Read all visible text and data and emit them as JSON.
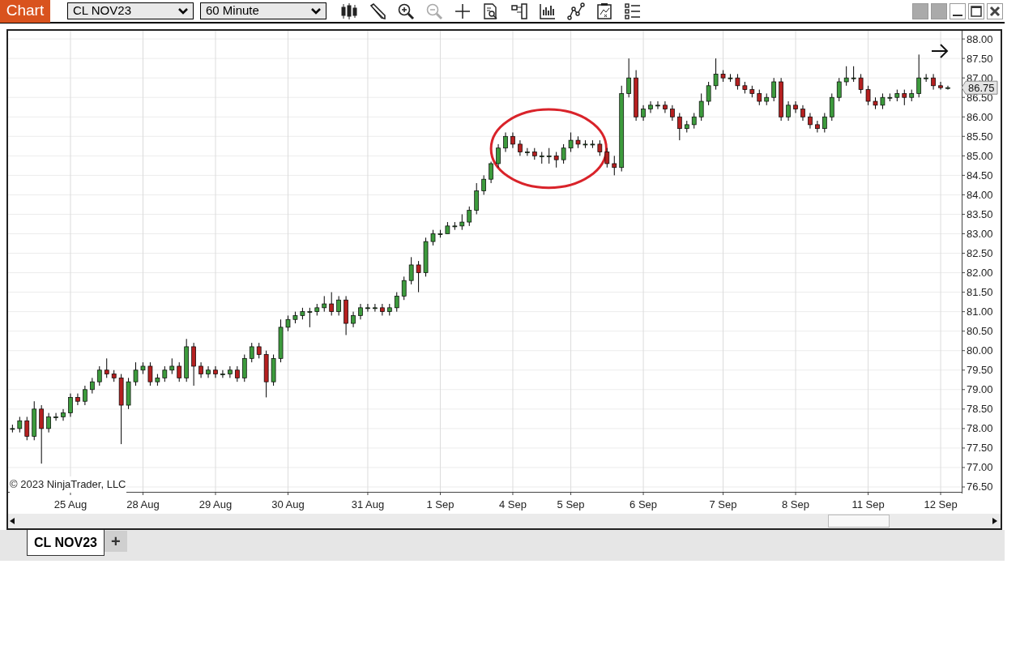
{
  "toolbar": {
    "title": "Chart",
    "instrument": "CL NOV23",
    "interval": "60 Minute"
  },
  "chart": {
    "copyright": "© 2023 NinjaTrader, LLC",
    "price_marker": "86.75",
    "highlight": {
      "kind": "ellipse"
    },
    "chart_data": {
      "type": "candlestick",
      "grid": true,
      "categories": [
        null,
        null,
        null,
        null,
        null,
        null,
        null,
        null,
        "25 Aug",
        null,
        null,
        null,
        null,
        null,
        null,
        null,
        null,
        null,
        "28 Aug",
        null,
        null,
        null,
        null,
        null,
        null,
        null,
        null,
        null,
        "29 Aug",
        null,
        null,
        null,
        null,
        null,
        null,
        null,
        null,
        null,
        "30 Aug",
        null,
        null,
        null,
        null,
        null,
        null,
        null,
        null,
        null,
        null,
        "31 Aug",
        null,
        null,
        null,
        null,
        null,
        null,
        null,
        null,
        null,
        "1 Sep",
        null,
        null,
        null,
        null,
        null,
        null,
        null,
        null,
        null,
        "4 Sep",
        null,
        null,
        null,
        null,
        null,
        null,
        null,
        "5 Sep",
        null,
        null,
        null,
        null,
        null,
        null,
        null,
        null,
        null,
        "6 Sep",
        null,
        null,
        null,
        null,
        null,
        null,
        null,
        null,
        null,
        null,
        "7 Sep",
        null,
        null,
        null,
        null,
        null,
        null,
        null,
        null,
        null,
        "8 Sep",
        null,
        null,
        null,
        null,
        null,
        null,
        null,
        null,
        null,
        "11 Sep",
        null,
        null,
        null,
        null,
        null,
        null,
        null,
        null,
        null,
        "12 Sep",
        null
      ],
      "ohlc": [
        [
          78.0,
          78.1,
          77.9,
          78.0
        ],
        [
          78.0,
          78.3,
          77.9,
          78.2
        ],
        [
          78.2,
          78.3,
          77.7,
          77.8
        ],
        [
          77.8,
          78.7,
          77.7,
          78.5
        ],
        [
          78.5,
          78.6,
          77.1,
          78.0
        ],
        [
          78.0,
          78.4,
          77.9,
          78.3
        ],
        [
          78.3,
          78.4,
          78.2,
          78.3
        ],
        [
          78.3,
          78.5,
          78.2,
          78.4
        ],
        [
          78.4,
          78.9,
          78.3,
          78.8
        ],
        [
          78.8,
          78.9,
          78.6,
          78.7
        ],
        [
          78.7,
          79.1,
          78.6,
          79.0
        ],
        [
          79.0,
          79.3,
          78.9,
          79.2
        ],
        [
          79.2,
          79.6,
          79.1,
          79.5
        ],
        [
          79.5,
          79.8,
          79.3,
          79.4
        ],
        [
          79.4,
          79.5,
          79.2,
          79.3
        ],
        [
          79.3,
          79.4,
          77.6,
          78.6
        ],
        [
          78.6,
          79.3,
          78.5,
          79.2
        ],
        [
          79.2,
          79.7,
          79.1,
          79.5
        ],
        [
          79.5,
          79.7,
          79.4,
          79.6
        ],
        [
          79.6,
          79.7,
          79.1,
          79.2
        ],
        [
          79.2,
          79.4,
          79.1,
          79.3
        ],
        [
          79.3,
          79.6,
          79.2,
          79.5
        ],
        [
          79.5,
          79.8,
          79.4,
          79.6
        ],
        [
          79.6,
          79.7,
          79.2,
          79.3
        ],
        [
          79.3,
          80.3,
          79.2,
          80.1
        ],
        [
          80.1,
          80.2,
          79.1,
          79.6
        ],
        [
          79.6,
          79.7,
          79.3,
          79.4
        ],
        [
          79.4,
          79.6,
          79.3,
          79.5
        ],
        [
          79.5,
          79.6,
          79.3,
          79.4
        ],
        [
          79.4,
          79.5,
          79.3,
          79.4
        ],
        [
          79.4,
          79.6,
          79.3,
          79.5
        ],
        [
          79.5,
          79.6,
          79.2,
          79.3
        ],
        [
          79.3,
          79.9,
          79.2,
          79.8
        ],
        [
          79.8,
          80.2,
          79.7,
          80.1
        ],
        [
          80.1,
          80.2,
          79.8,
          79.9
        ],
        [
          79.9,
          80.0,
          78.8,
          79.2
        ],
        [
          79.2,
          79.9,
          79.1,
          79.8
        ],
        [
          79.8,
          80.8,
          79.7,
          80.6
        ],
        [
          80.6,
          80.9,
          80.5,
          80.8
        ],
        [
          80.8,
          81.0,
          80.7,
          80.9
        ],
        [
          80.9,
          81.1,
          80.8,
          81.0
        ],
        [
          81.0,
          81.1,
          80.6,
          81.0
        ],
        [
          81.0,
          81.2,
          80.9,
          81.1
        ],
        [
          81.1,
          81.4,
          81.0,
          81.2
        ],
        [
          81.2,
          81.5,
          80.9,
          81.0
        ],
        [
          81.0,
          81.4,
          80.9,
          81.3
        ],
        [
          81.3,
          81.4,
          80.4,
          80.7
        ],
        [
          80.7,
          81.0,
          80.6,
          80.9
        ],
        [
          80.9,
          81.2,
          80.8,
          81.1
        ],
        [
          81.1,
          81.2,
          81.0,
          81.1
        ],
        [
          81.1,
          81.2,
          81.0,
          81.1
        ],
        [
          81.1,
          81.2,
          80.9,
          81.0
        ],
        [
          81.0,
          81.2,
          80.9,
          81.1
        ],
        [
          81.1,
          81.5,
          81.0,
          81.4
        ],
        [
          81.4,
          81.9,
          81.3,
          81.8
        ],
        [
          81.8,
          82.4,
          81.7,
          82.2
        ],
        [
          82.2,
          82.3,
          81.5,
          82.0
        ],
        [
          82.0,
          82.9,
          81.9,
          82.8
        ],
        [
          82.8,
          83.1,
          82.7,
          83.0
        ],
        [
          83.0,
          83.1,
          82.9,
          83.0
        ],
        [
          83.0,
          83.3,
          83.0,
          83.2
        ],
        [
          83.2,
          83.3,
          83.1,
          83.2
        ],
        [
          83.2,
          83.5,
          83.1,
          83.3
        ],
        [
          83.3,
          83.7,
          83.2,
          83.6
        ],
        [
          83.6,
          84.3,
          83.5,
          84.1
        ],
        [
          84.1,
          84.5,
          84.0,
          84.4
        ],
        [
          84.4,
          84.85,
          84.3,
          84.8
        ],
        [
          84.8,
          85.3,
          84.7,
          85.2
        ],
        [
          85.2,
          85.6,
          85.1,
          85.5
        ],
        [
          85.5,
          85.6,
          85.2,
          85.3
        ],
        [
          85.3,
          85.4,
          85.0,
          85.1
        ],
        [
          85.1,
          85.2,
          85.0,
          85.1
        ],
        [
          85.1,
          85.2,
          84.9,
          85.0
        ],
        [
          85.0,
          85.1,
          84.8,
          85.0
        ],
        [
          85.0,
          85.2,
          84.8,
          85.0
        ],
        [
          85.0,
          85.1,
          84.7,
          84.9
        ],
        [
          84.9,
          85.3,
          84.8,
          85.2
        ],
        [
          85.2,
          85.6,
          85.1,
          85.4
        ],
        [
          85.4,
          85.5,
          85.2,
          85.3
        ],
        [
          85.3,
          85.4,
          85.2,
          85.3
        ],
        [
          85.3,
          85.4,
          85.2,
          85.3
        ],
        [
          85.3,
          85.4,
          85.0,
          85.1
        ],
        [
          85.1,
          85.2,
          84.7,
          84.8
        ],
        [
          84.8,
          85.0,
          84.5,
          84.7
        ],
        [
          84.7,
          86.8,
          84.6,
          86.6
        ],
        [
          86.6,
          87.5,
          86.5,
          87.0
        ],
        [
          87.0,
          87.2,
          85.9,
          86.0
        ],
        [
          86.0,
          86.3,
          85.9,
          86.2
        ],
        [
          86.2,
          86.4,
          86.1,
          86.3
        ],
        [
          86.3,
          86.4,
          86.2,
          86.3
        ],
        [
          86.3,
          86.4,
          86.1,
          86.2
        ],
        [
          86.2,
          86.3,
          85.9,
          86.0
        ],
        [
          86.0,
          86.1,
          85.4,
          85.7
        ],
        [
          85.7,
          85.9,
          85.6,
          85.8
        ],
        [
          85.8,
          86.1,
          85.7,
          86.0
        ],
        [
          86.0,
          86.6,
          85.9,
          86.4
        ],
        [
          86.4,
          86.9,
          86.3,
          86.8
        ],
        [
          86.8,
          87.5,
          86.7,
          87.1
        ],
        [
          87.1,
          87.2,
          86.9,
          87.0
        ],
        [
          87.0,
          87.1,
          86.9,
          87.0
        ],
        [
          87.0,
          87.1,
          86.7,
          86.8
        ],
        [
          86.8,
          86.9,
          86.6,
          86.7
        ],
        [
          86.7,
          86.8,
          86.5,
          86.6
        ],
        [
          86.6,
          86.7,
          86.3,
          86.4
        ],
        [
          86.4,
          86.6,
          86.3,
          86.5
        ],
        [
          86.5,
          87.0,
          86.4,
          86.9
        ],
        [
          86.9,
          87.0,
          85.9,
          86.0
        ],
        [
          86.0,
          86.4,
          85.9,
          86.3
        ],
        [
          86.3,
          86.4,
          86.1,
          86.2
        ],
        [
          86.2,
          86.3,
          85.9,
          86.0
        ],
        [
          86.0,
          86.1,
          85.7,
          85.8
        ],
        [
          85.8,
          85.9,
          85.6,
          85.7
        ],
        [
          85.7,
          86.1,
          85.6,
          86.0
        ],
        [
          86.0,
          86.6,
          85.9,
          86.5
        ],
        [
          86.5,
          87.0,
          86.4,
          86.9
        ],
        [
          86.9,
          87.3,
          86.8,
          87.0
        ],
        [
          87.0,
          87.3,
          86.9,
          87.0
        ],
        [
          87.0,
          87.1,
          86.6,
          86.7
        ],
        [
          86.7,
          86.8,
          86.3,
          86.4
        ],
        [
          86.4,
          86.5,
          86.2,
          86.3
        ],
        [
          86.3,
          86.6,
          86.2,
          86.5
        ],
        [
          86.5,
          86.6,
          86.4,
          86.5
        ],
        [
          86.5,
          86.7,
          86.4,
          86.6
        ],
        [
          86.6,
          86.7,
          86.3,
          86.5
        ],
        [
          86.5,
          86.7,
          86.4,
          86.6
        ],
        [
          86.6,
          87.6,
          86.5,
          87.0
        ],
        [
          87.0,
          87.1,
          86.9,
          87.0
        ],
        [
          87.0,
          87.1,
          86.7,
          86.8
        ],
        [
          86.8,
          86.9,
          86.7,
          86.75
        ],
        [
          86.75,
          86.8,
          86.7,
          86.75
        ]
      ],
      "ylim": [
        76.375,
        88.21
      ],
      "yticks": [
        {
          "value": 76.5,
          "label": "76.50"
        },
        {
          "value": 77,
          "label": "77.00"
        },
        {
          "value": 77.5,
          "label": "77.50"
        },
        {
          "value": 78,
          "label": "78.00"
        },
        {
          "value": 78.5,
          "label": "78.50"
        },
        {
          "value": 79,
          "label": "79.00"
        },
        {
          "value": 79.5,
          "label": "79.50"
        },
        {
          "value": 80,
          "label": "80.00"
        },
        {
          "value": 80.5,
          "label": "80.50"
        },
        {
          "value": 81,
          "label": "81.00"
        },
        {
          "value": 81.5,
          "label": "81.50"
        },
        {
          "value": 82,
          "label": "82.00"
        },
        {
          "value": 82.5,
          "label": "82.50"
        },
        {
          "value": 83,
          "label": "83.00"
        },
        {
          "value": 83.5,
          "label": "83.50"
        },
        {
          "value": 84,
          "label": "84.00"
        },
        {
          "value": 84.5,
          "label": "84.50"
        },
        {
          "value": 85,
          "label": "85.00"
        },
        {
          "value": 85.5,
          "label": "85.50"
        },
        {
          "value": 86,
          "label": "86.00"
        },
        {
          "value": 86.5,
          "label": "86.50"
        },
        {
          "value": 87,
          "label": "87.00"
        },
        {
          "value": 87.5,
          "label": "87.50"
        },
        {
          "value": 88,
          "label": "88.00"
        }
      ]
    }
  },
  "tabs": [
    {
      "label": "CL NOV23",
      "selected": true
    }
  ],
  "add_tab": "+"
}
